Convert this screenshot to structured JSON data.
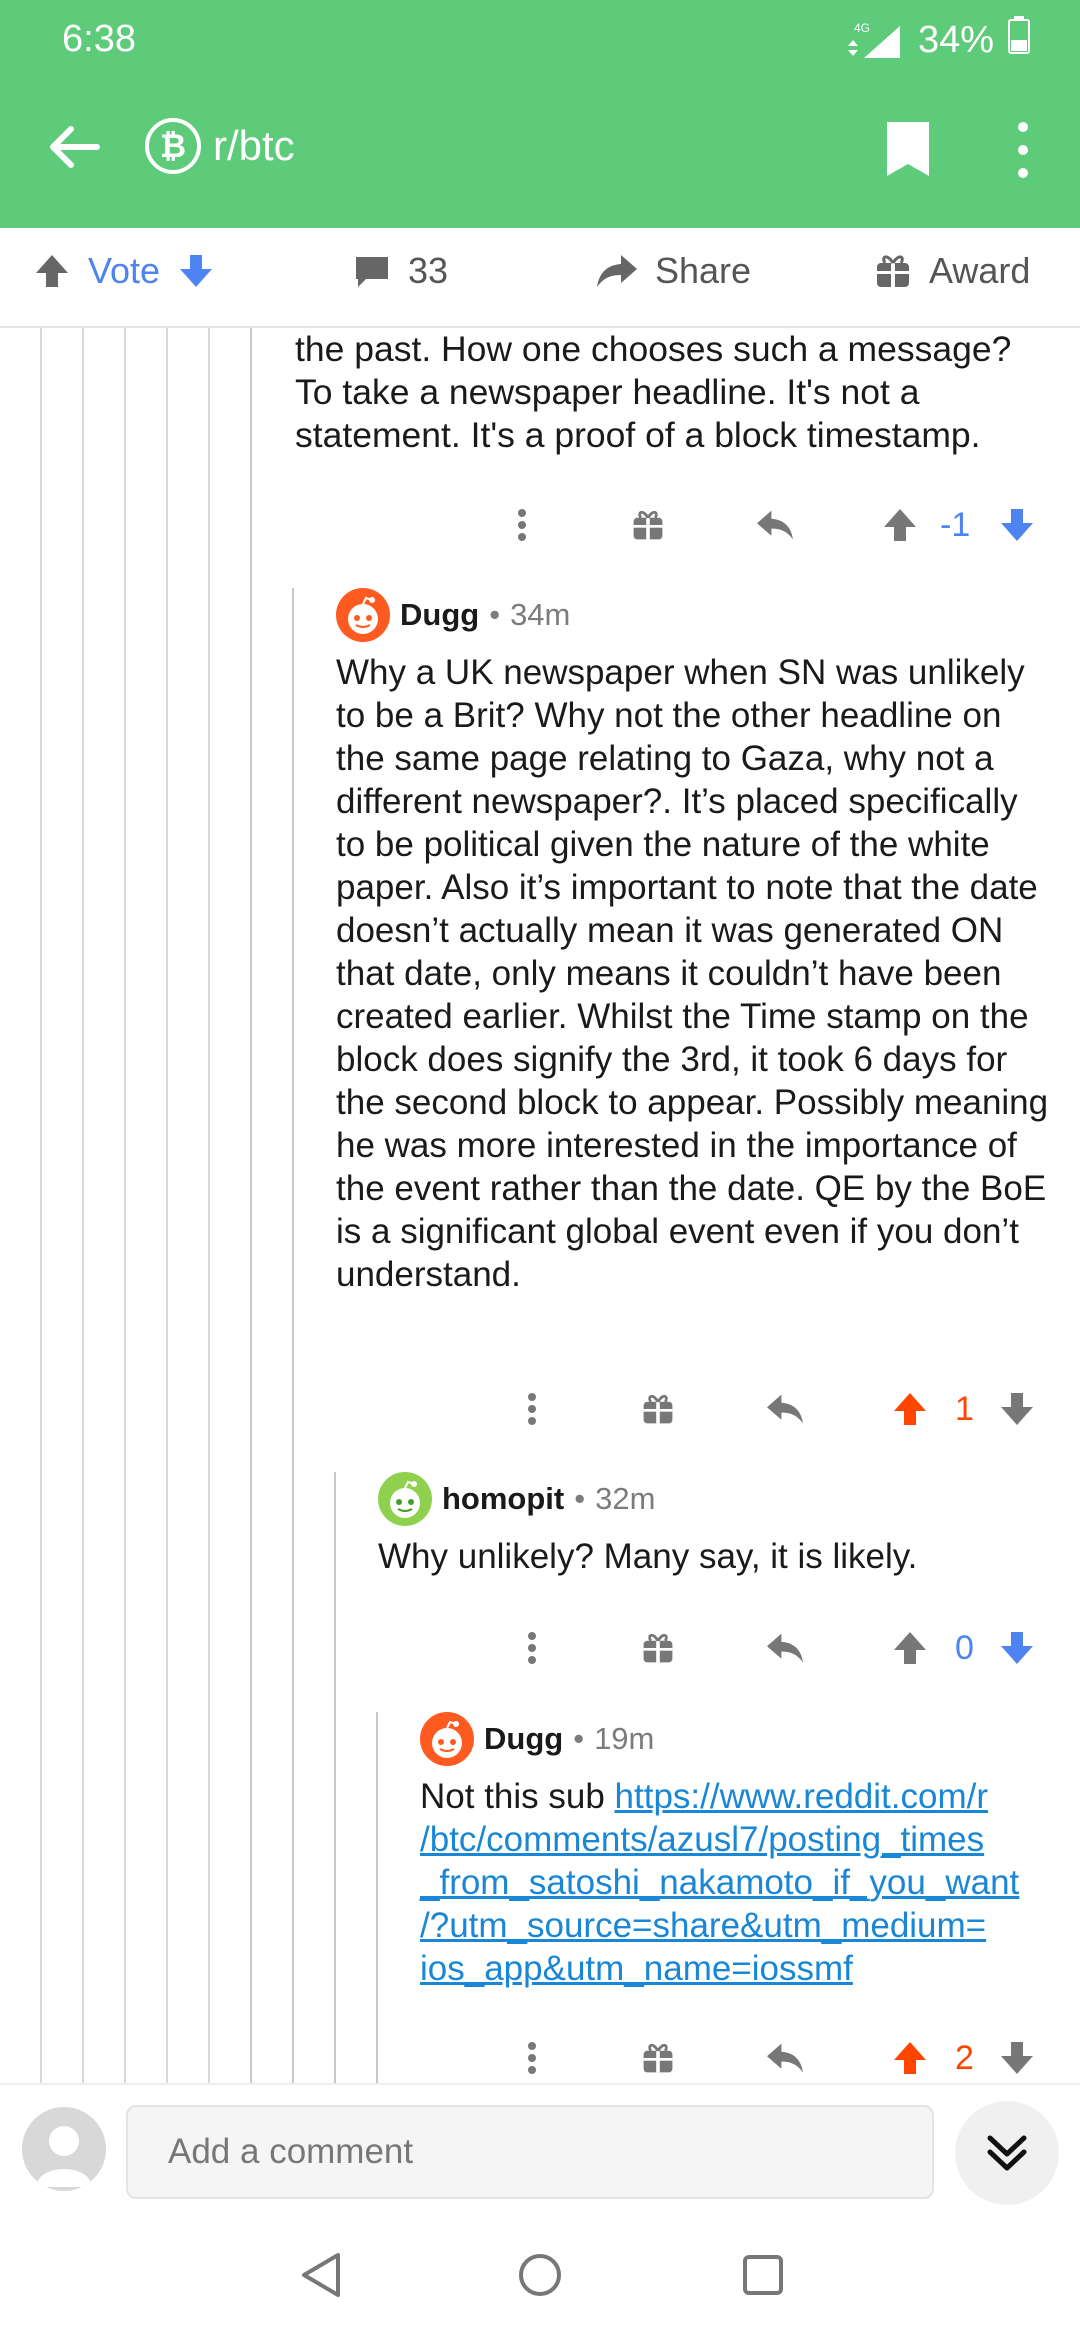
{
  "status_bar": {
    "time": "6:38",
    "network": "4G",
    "battery": "34%"
  },
  "app_bar": {
    "subreddit": "r/btc",
    "subreddit_icon": "bitcoin-b"
  },
  "action_bar": {
    "vote_label": "Vote",
    "comment_count": "33",
    "share_label": "Share",
    "award_label": "Award"
  },
  "comments": [
    {
      "text": "the past. How one chooses such a message? To take a newspaper headline. It's not a statement. It's a proof of a block timestamp.",
      "score": "-1",
      "vote_state": "none"
    },
    {
      "author": "Dugg",
      "age": "34m",
      "text": "Why a UK newspaper when SN was unlikely to be a Brit? Why not the other headline on the same page relating to Gaza, why not a different newspaper?. It’s placed specifically to be political given the nature of the white paper. Also it’s important to note that the date doesn’t actually mean it was generated ON that date, only means it couldn’t have been created earlier. Whilst the Time stamp on the block does signify the 3rd, it took 6 days for the second block to appear. Possibly meaning he was more interested in the importance of the event rather than the date. QE by the BoE is a significant global event even if you don’t understand.",
      "score": "1",
      "vote_state": "upvoted"
    },
    {
      "author": "homopit",
      "age": "32m",
      "text": "Why unlikely? Many say, it is likely.",
      "score": "0",
      "vote_state": "none"
    },
    {
      "author": "Dugg",
      "age": "19m",
      "prefix": "Not this sub ",
      "link_line1": "https://www.reddit.com/r",
      "link_line2": "/btc/comments/azusl7/posting_times",
      "link_line3": "_from_satoshi_nakamoto_if_you_want",
      "link_line4": "/?utm_source=share&utm_medium=",
      "link_line5": "ios_app&utm_name=iossmf",
      "score": "2",
      "vote_state": "upvoted"
    }
  ],
  "composer": {
    "placeholder": "Add a comment"
  },
  "colors": {
    "brand": "#5ecb7a",
    "upvote": "#ff4500",
    "downvote": "#4d84f2",
    "link": "#1a86d6"
  }
}
